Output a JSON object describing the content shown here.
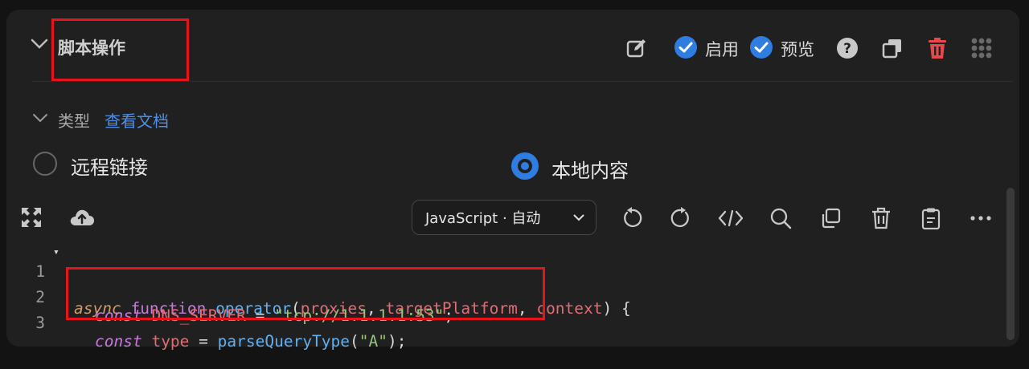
{
  "header": {
    "title": "脚本操作",
    "enable_label": "启用",
    "preview_label": "预览"
  },
  "type_section": {
    "label": "类型",
    "doc_link": "查看文档",
    "options": [
      {
        "label": "远程链接",
        "selected": false
      },
      {
        "label": "本地内容",
        "selected": true
      }
    ]
  },
  "editor": {
    "language_select": "JavaScript · 自动",
    "lines": [
      {
        "num": "1",
        "fold": "▾"
      },
      {
        "num": "2",
        "fold": ""
      },
      {
        "num": "3",
        "fold": ""
      }
    ],
    "code": {
      "l1": {
        "async": "async",
        "function": "function",
        "name": "operator",
        "open": "(",
        "p1": "proxies",
        "c1": ", ",
        "p2": "targetPlatform",
        "c2": ", ",
        "p3": "context",
        "close": ") {"
      },
      "l2": {
        "const": "const",
        "var": "DNS_SERVER",
        "eq": " = ",
        "str": "\"tcp://1.1.1.1:53\"",
        "end": ";"
      },
      "l3": {
        "const": "const",
        "var": "type",
        "eq": " = ",
        "fn": "parseQueryType",
        "open": "(",
        "str": "\"A\"",
        "end": ");"
      }
    }
  },
  "colors": {
    "accent": "#2f7de1",
    "danger": "#e5484d",
    "highlight": "#e8141b",
    "link": "#4d8fe8"
  },
  "icons": [
    "chevron-down-icon",
    "edit-icon",
    "check-circle-icon",
    "help-icon",
    "copy-icon",
    "trash-icon",
    "grid-icon",
    "expand-icon",
    "cloud-upload-icon",
    "undo-icon",
    "redo-icon",
    "code-icon",
    "search-icon",
    "duplicate-icon",
    "delete-icon",
    "clipboard-icon",
    "more-icon"
  ]
}
